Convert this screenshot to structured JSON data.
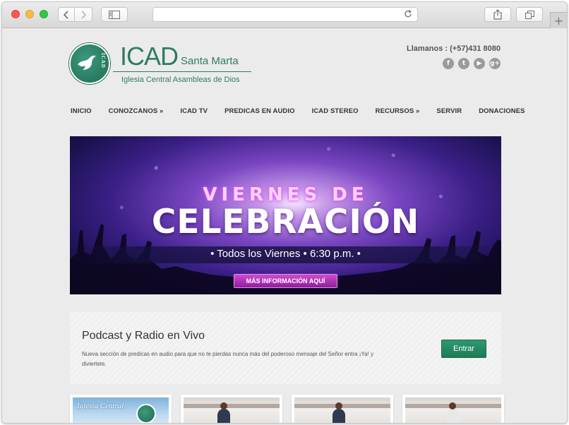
{
  "browser": {
    "address": "",
    "newtab_label": "+"
  },
  "site": {
    "logo": {
      "name": "ICAD",
      "city": "Santa Marta",
      "subtitle": "Iglesia Central Asambleas de Dios",
      "badge": "ICAD"
    },
    "phone": "Llamanos : (+57)431 8080",
    "social": [
      {
        "name": "facebook-icon",
        "glyph": "f"
      },
      {
        "name": "twitter-icon",
        "glyph": "t"
      },
      {
        "name": "youtube-icon",
        "glyph": "▶"
      },
      {
        "name": "googleplus-icon",
        "glyph": "g+"
      }
    ],
    "nav": [
      "INICIO",
      "CONOZCANOS »",
      "ICAD TV",
      "PREDICAS EN AUDIO",
      "ICAD STEREO",
      "RECURSOS »",
      "SERVIR",
      "DONACIONES"
    ]
  },
  "banner": {
    "line1": "VIERNES DE",
    "line2": "CELEBRACIÓN",
    "schedule": "• Todos los Viernes • 6:30 p.m. •",
    "cta": "MÁS INFORMACIÓN AQUÍ"
  },
  "podcast": {
    "title": "Podcast y Radio en Vivo",
    "text": "Nueva sección de predicas en audio para que no te pierdas nunca más del poderoso mensaje del Señor entra ¡Ya! y diviertete.",
    "button": "Entrar"
  },
  "thumbnails": [
    {
      "caption": "Iglesia Central"
    },
    {
      "caption": ""
    },
    {
      "caption": ""
    },
    {
      "caption": ""
    }
  ],
  "colors": {
    "brand_green": "#2e7c61",
    "button_green": "#1f7a56",
    "cta_purple": "#a52ab3"
  }
}
